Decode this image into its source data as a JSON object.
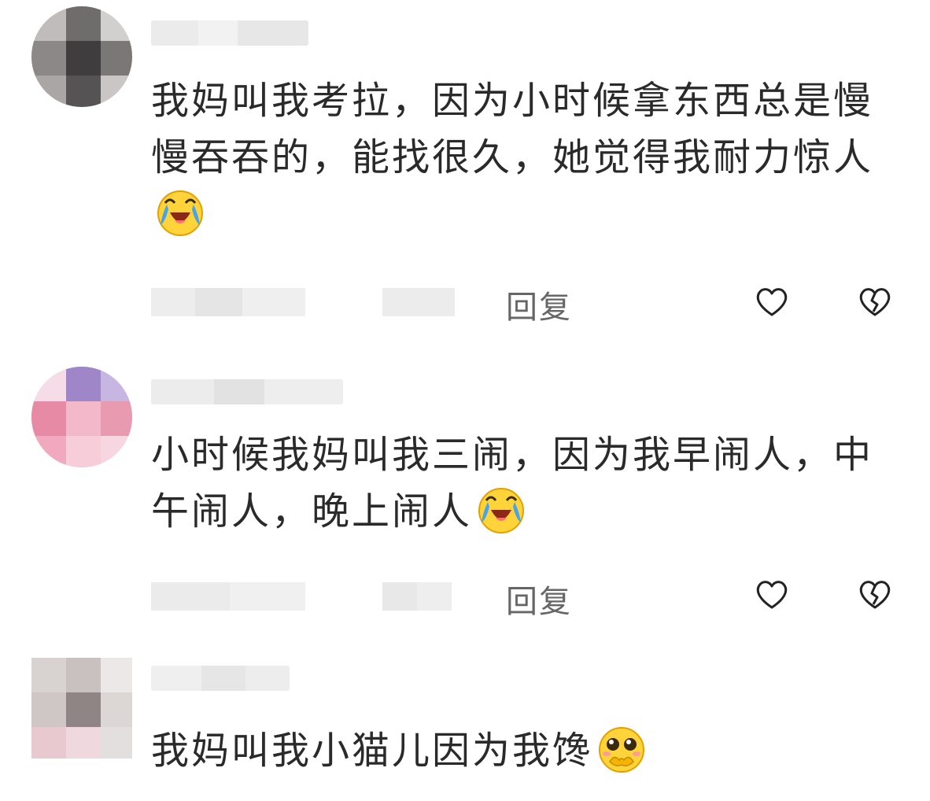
{
  "comments": [
    {
      "text": "我妈叫我考拉，因为小时候拿东西总是慢慢吞吞的，能找很久，她觉得我耐力惊人",
      "emoji": "laugh-cry-emoji",
      "reply_label": "回复",
      "like_icon": "heart-icon",
      "dislike_icon": "broken-heart-icon"
    },
    {
      "text": "小时候我妈叫我三闹，因为我早闹人，中午闹人，晚上闹人",
      "emoji": "laugh-cry-emoji",
      "reply_label": "回复",
      "like_icon": "heart-icon",
      "dislike_icon": "broken-heart-icon"
    },
    {
      "text": "我妈叫我小猫儿因为我馋",
      "emoji": "pleading-emoji"
    }
  ],
  "colors": {
    "text": "#2a2a2a",
    "muted": "#666666",
    "emoji_yellow": "#ffd43b",
    "emoji_tears": "#4aa3e8"
  }
}
